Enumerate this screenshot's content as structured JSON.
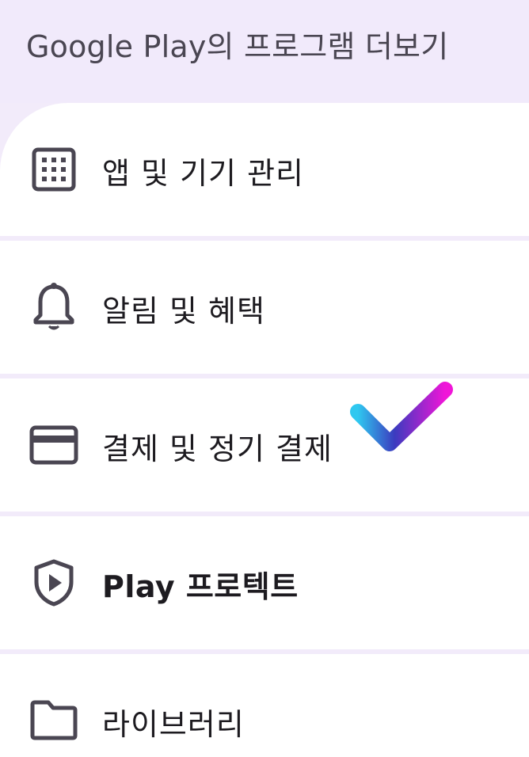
{
  "header": {
    "title": "Google Play의 프로그램 더보기"
  },
  "menu": {
    "items": [
      {
        "label": "앱 및 기기 관리",
        "icon": "grid-icon"
      },
      {
        "label": "알림 및 혜택",
        "icon": "bell-icon"
      },
      {
        "label": "결제 및 정기 결제",
        "icon": "credit-card-icon"
      },
      {
        "label": "Play 프로텍트",
        "icon": "shield-play-icon"
      },
      {
        "label": "라이브러리",
        "icon": "folder-icon"
      }
    ]
  },
  "overlay": {
    "icon": "checkmark-icon",
    "gradient_start": "#2fc8f0",
    "gradient_mid": "#3b3bbf",
    "gradient_end": "#f015d8"
  },
  "colors": {
    "header_bg": "#f1eafb",
    "separator": "#f2ebfa",
    "item_bg": "#ffffff",
    "icon": "#4a4652",
    "text": "#1d1b20"
  }
}
